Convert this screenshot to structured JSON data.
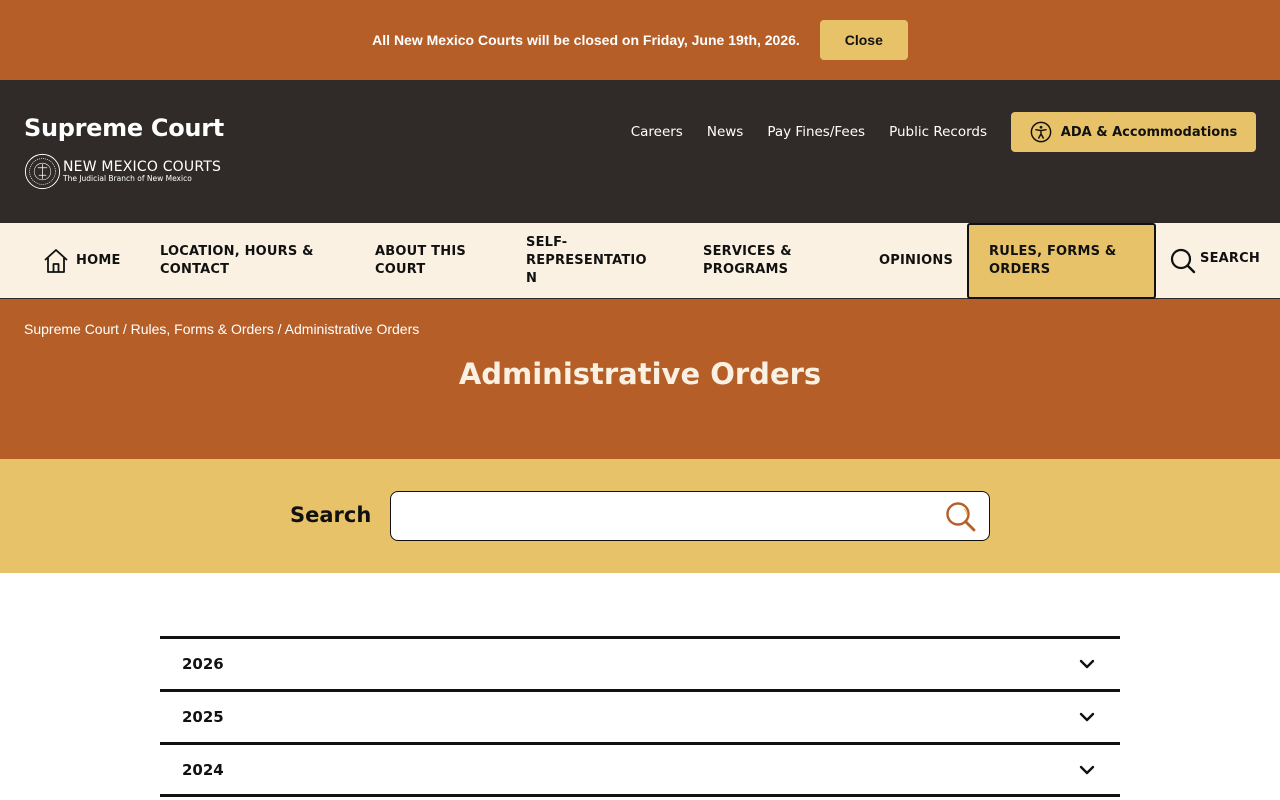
{
  "alert": {
    "message": "All New Mexico Courts will be closed on Friday, June 19th, 2026.",
    "close_label": "Close"
  },
  "header": {
    "site_title": "Supreme Court",
    "brand_name": "NEW MEXICO COURTS",
    "brand_tagline": "The Judicial Branch of New Mexico",
    "utility_links": [
      "Careers",
      "News",
      "Pay Fines/Fees",
      "Public Records"
    ],
    "ada_label": "ADA & Accommodations"
  },
  "nav": {
    "home": "HOME",
    "location": "LOCATION, HOURS & CONTACT",
    "about": "ABOUT THIS COURT",
    "self_rep": "SELF-REPRESENTATION",
    "services": "SERVICES & PROGRAMS",
    "opinions": "OPINIONS",
    "rules": "RULES, FORMS & ORDERS",
    "search": "SEARCH"
  },
  "breadcrumb": {
    "items": [
      "Supreme Court",
      "Rules, Forms & Orders",
      "Administrative Orders"
    ],
    "separator": " / "
  },
  "page_title": "Administrative Orders",
  "search": {
    "label": "Search",
    "value": "",
    "placeholder": ""
  },
  "accordion": [
    "2026",
    "2025",
    "2024"
  ],
  "colors": {
    "rust": "#b55e27",
    "gold": "#e8c268",
    "dark": "#302b28",
    "cream": "#faf1e2"
  }
}
